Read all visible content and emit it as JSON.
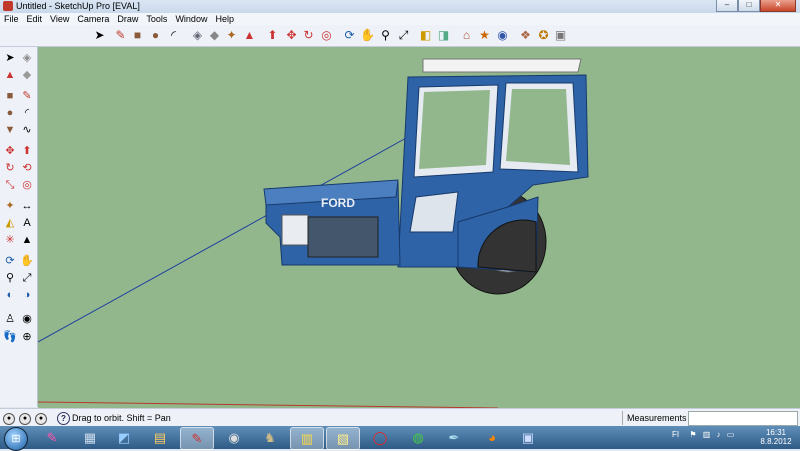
{
  "window": {
    "title": "Untitled - SketchUp Pro [EVAL]",
    "minimize": "–",
    "maximize": "□",
    "close": "✕"
  },
  "menu": [
    "File",
    "Edit",
    "View",
    "Camera",
    "Draw",
    "Tools",
    "Window",
    "Help"
  ],
  "status": {
    "hint": "Drag to orbit.  Shift = Pan",
    "help": "?",
    "measurements_label": "Measurements",
    "measurements_value": ""
  },
  "clock": {
    "time": "16:31",
    "date": "8.8.2012"
  },
  "tray": {
    "lang": "FI"
  },
  "model": {
    "brand": "FORD"
  },
  "colors": {
    "viewport": "#93b78d",
    "tractor_blue": "#2f63a8",
    "axis": "#1f3f9e",
    "axis_red": "#b43a2a"
  }
}
